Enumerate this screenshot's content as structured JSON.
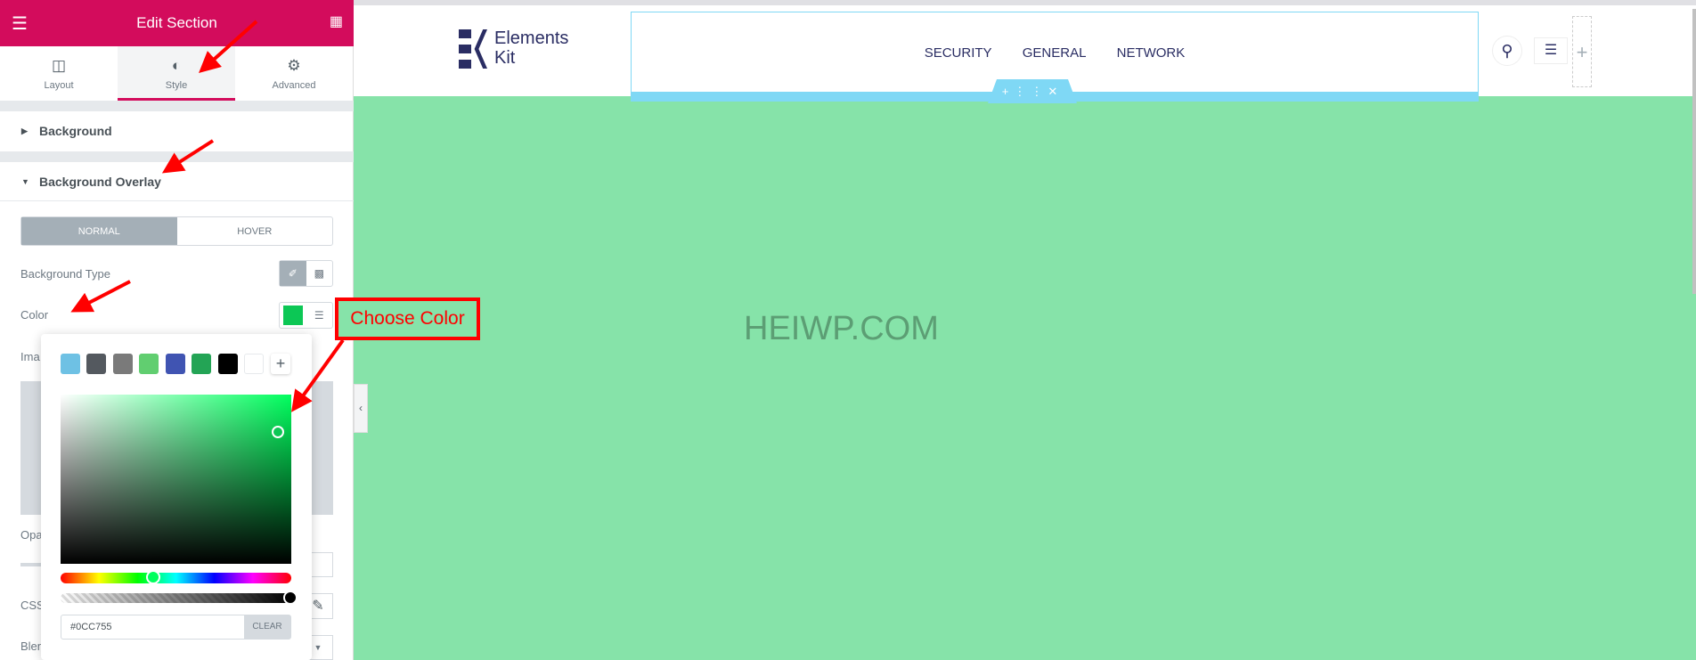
{
  "panel": {
    "title": "Edit Section",
    "tabs": [
      {
        "label": "Layout",
        "icon": "columns-icon"
      },
      {
        "label": "Style",
        "icon": "contrast-icon",
        "active": true
      },
      {
        "label": "Advanced",
        "icon": "gear-icon"
      }
    ],
    "sections": {
      "background": "Background",
      "background_overlay": "Background Overlay"
    },
    "state_tabs": {
      "normal": "NORMAL",
      "hover": "HOVER",
      "active": "NORMAL"
    },
    "fields": {
      "background_type": "Background Type",
      "color": "Color",
      "image": "Ima",
      "opacity": "Opa",
      "css_filters": "CSS",
      "blend_mode": "Blen"
    },
    "accent": "#d30c5c"
  },
  "color_picker": {
    "swatches": [
      "#6ec1e4",
      "#54595f",
      "#7a7a7a",
      "#61ce70",
      "#4054b2",
      "#23a455",
      "#000000",
      "#ffffff"
    ],
    "hex_value": "#0CC755",
    "clear_label": "CLEAR",
    "selected_color": "#0cc755"
  },
  "site": {
    "logo": {
      "line1": "Elements",
      "line2": "Kit"
    },
    "nav": [
      "SECURITY",
      "GENERAL",
      "NETWORK"
    ],
    "watermark": "HEIWP.COM",
    "section_background": "#86e3a9"
  },
  "annotation": {
    "label": "Choose Color"
  }
}
